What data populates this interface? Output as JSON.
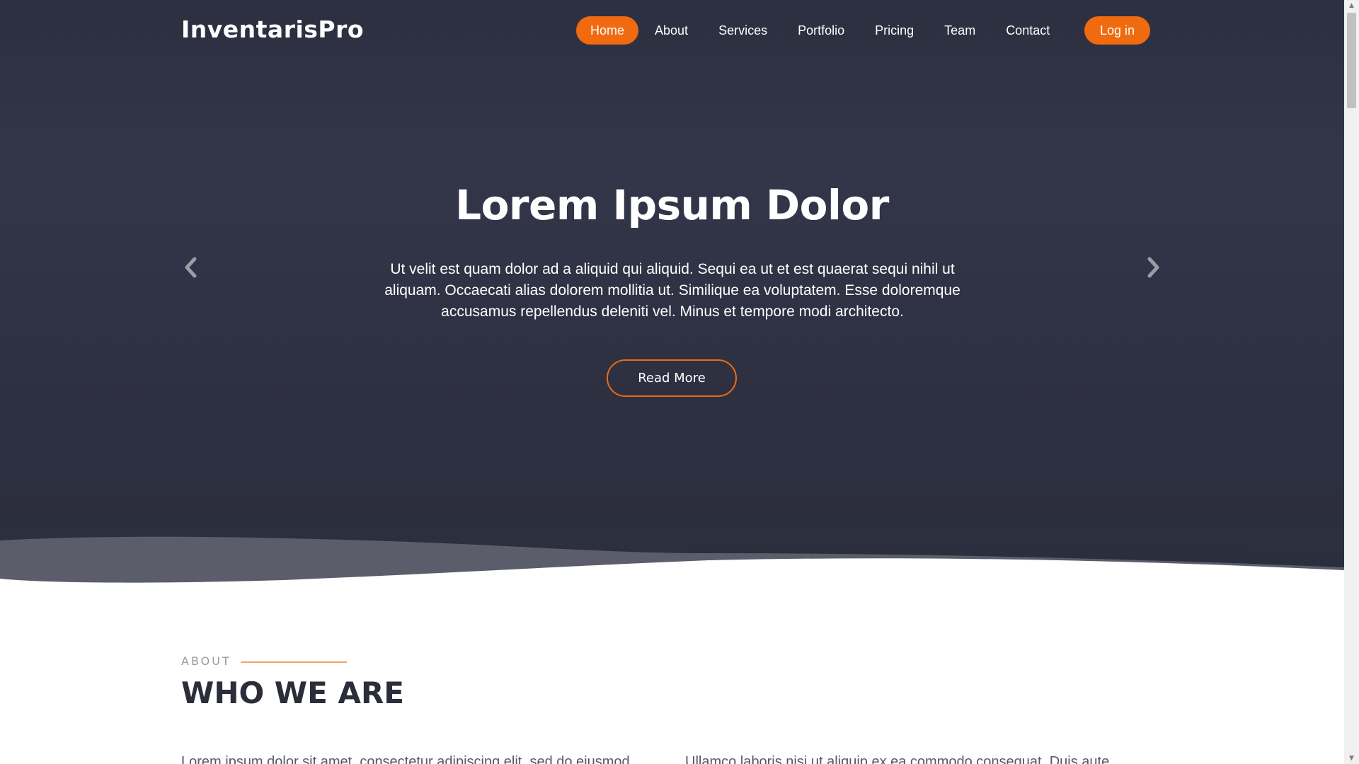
{
  "brand": {
    "logo": "InventarisPro"
  },
  "nav": {
    "items": [
      {
        "label": "Home",
        "active": true
      },
      {
        "label": "About"
      },
      {
        "label": "Services"
      },
      {
        "label": "Portfolio"
      },
      {
        "label": "Pricing"
      },
      {
        "label": "Team"
      },
      {
        "label": "Contact"
      }
    ],
    "login_label": "Log in"
  },
  "hero": {
    "title": "Lorem Ipsum Dolor",
    "text": "Ut velit est quam dolor ad a aliquid qui aliquid. Sequi ea ut et est quaerat sequi nihil ut aliquam. Occaecati alias dolorem mollitia ut. Similique ea voluptatem. Esse doloremque accusamus repellendus deleniti vel. Minus et tempore modi architecto.",
    "button_label": "Read More",
    "prev_icon": "chevron-left-icon",
    "next_icon": "chevron-right-icon"
  },
  "about": {
    "label": "ABOUT",
    "heading": "WHO WE ARE",
    "col1": "Lorem ipsum dolor sit amet, consectetur adipiscing elit, sed do eiusmod",
    "col2": "Ullamco laboris nisi ut aliquip ex ea commodo consequat. Duis aute"
  },
  "colors": {
    "accent": "#f06a10",
    "hero_bg": "#2e3142",
    "heading": "#2b2d3b"
  }
}
